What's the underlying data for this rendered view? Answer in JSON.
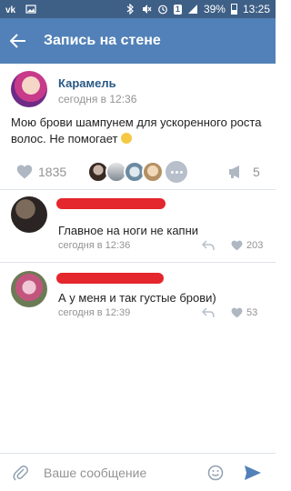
{
  "status_bar": {
    "battery": "39%",
    "time": "13:25",
    "sim_badge": "1",
    "icons": [
      "vk-notify-icon",
      "image-notify-icon",
      "bluetooth-icon",
      "mute-icon",
      "alarm-icon",
      "signal-icon",
      "battery-icon"
    ]
  },
  "header": {
    "title": "Запись на стене"
  },
  "post": {
    "author": "Карамель",
    "time": "сегодня в 12:36",
    "text": "Мою брови шампунем для ускоренного роста волос. Не помогает",
    "likes": "1835",
    "shares": "5"
  },
  "comments": [
    {
      "text": "Главное на ноги не капни",
      "time": "сегодня в 12:36",
      "likes": "203"
    },
    {
      "text": "А у меня и так густые брови)",
      "time": "сегодня в 12:39",
      "likes": "53"
    }
  ],
  "composer": {
    "placeholder": "Ваше сообщение"
  },
  "colors": {
    "header_bg": "#5181b8",
    "status_bg": "#3e5f86",
    "link": "#2a5885",
    "muted": "#939393",
    "redaction": "#e4262d"
  }
}
